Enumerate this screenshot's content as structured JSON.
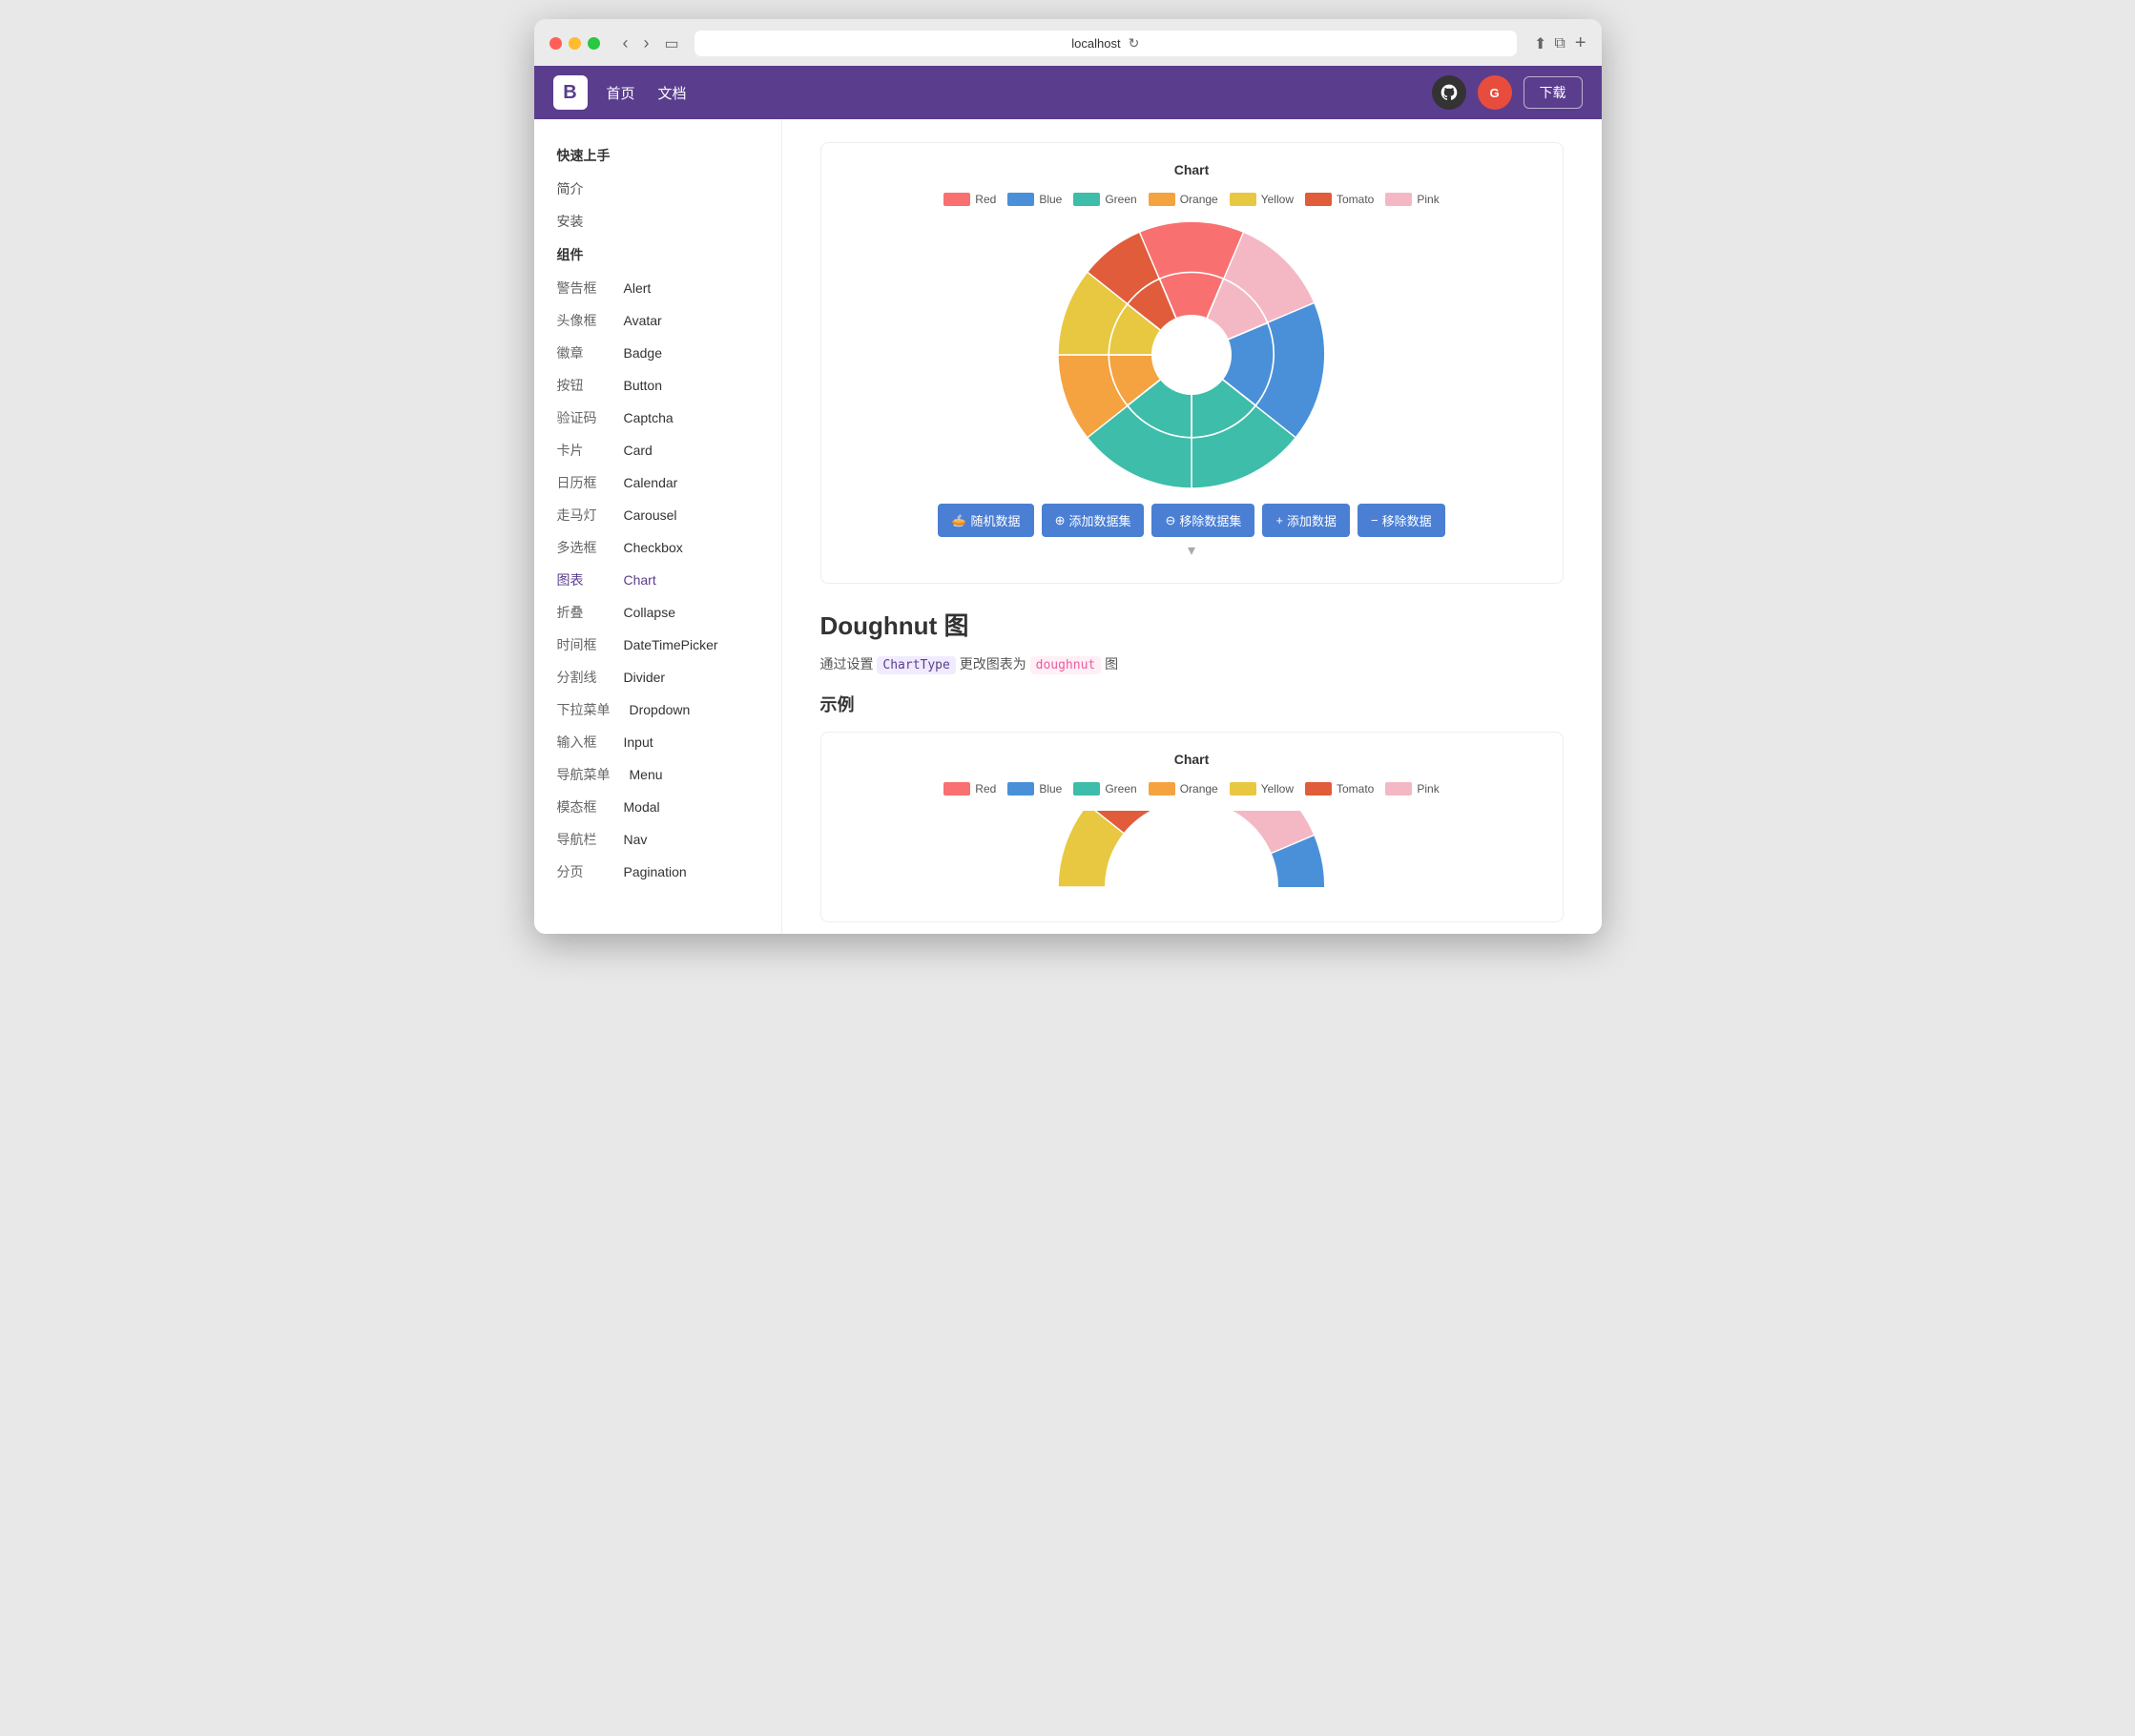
{
  "browser": {
    "url": "localhost",
    "tab_title": "localhost"
  },
  "header": {
    "logo": "B",
    "nav": [
      "首页",
      "文档"
    ],
    "download_label": "下载"
  },
  "sidebar": {
    "quick_start_title": "快速上手",
    "quick_items": [
      "简介",
      "安装"
    ],
    "components_title": "组件",
    "items": [
      {
        "zh": "警告框",
        "en": "Alert"
      },
      {
        "zh": "头像框",
        "en": "Avatar"
      },
      {
        "zh": "徽章",
        "en": "Badge"
      },
      {
        "zh": "按钮",
        "en": "Button"
      },
      {
        "zh": "验证码",
        "en": "Captcha"
      },
      {
        "zh": "卡片",
        "en": "Card"
      },
      {
        "zh": "日历框",
        "en": "Calendar"
      },
      {
        "zh": "走马灯",
        "en": "Carousel"
      },
      {
        "zh": "多选框",
        "en": "Checkbox"
      },
      {
        "zh": "图表",
        "en": "Chart",
        "active": true
      },
      {
        "zh": "折叠",
        "en": "Collapse"
      },
      {
        "zh": "时间框",
        "en": "DateTimePicker"
      },
      {
        "zh": "分割线",
        "en": "Divider"
      },
      {
        "zh": "下拉菜单",
        "en": "Dropdown"
      },
      {
        "zh": "输入框",
        "en": "Input"
      },
      {
        "zh": "导航菜单",
        "en": "Menu"
      },
      {
        "zh": "模态框",
        "en": "Modal"
      },
      {
        "zh": "导航栏",
        "en": "Nav"
      },
      {
        "zh": "分页",
        "en": "Pagination"
      }
    ]
  },
  "chart_section": {
    "title": "Chart",
    "legend": [
      {
        "label": "Red",
        "color": "#f97070"
      },
      {
        "label": "Blue",
        "color": "#4a90d9"
      },
      {
        "label": "Green",
        "color": "#3dbdaa"
      },
      {
        "label": "Orange",
        "color": "#f4a340"
      },
      {
        "label": "Yellow",
        "color": "#e8c840"
      },
      {
        "label": "Tomato",
        "color": "#e05c3a"
      },
      {
        "label": "Pink",
        "color": "#f4b8c4"
      }
    ],
    "buttons": [
      {
        "icon": "🥧",
        "label": "随机数据"
      },
      {
        "icon": "⊕",
        "label": "添加数据集"
      },
      {
        "icon": "⊖",
        "label": "移除数据集"
      },
      {
        "icon": "+",
        "label": "添加数据"
      },
      {
        "icon": "−",
        "label": "移除数据"
      }
    ]
  },
  "doughnut_section": {
    "heading": "Doughnut 图",
    "desc_prefix": "通过设置",
    "code1": "ChartType",
    "desc_mid": " 更改图表为 ",
    "code2": "doughnut",
    "desc_suffix": " 图",
    "example_label": "示例",
    "chart2_title": "Chart",
    "legend2": [
      {
        "label": "Red",
        "color": "#f97070"
      },
      {
        "label": "Blue",
        "color": "#4a90d9"
      },
      {
        "label": "Green",
        "color": "#3dbdaa"
      },
      {
        "label": "Orange",
        "color": "#f4a340"
      },
      {
        "label": "Yellow",
        "color": "#e8c840"
      },
      {
        "label": "Tomato",
        "color": "#e05c3a"
      },
      {
        "label": "Pink",
        "color": "#f4b8c4"
      }
    ]
  },
  "colors": {
    "brand": "#5b3d8e",
    "accent_blue": "#4a7fd4"
  }
}
